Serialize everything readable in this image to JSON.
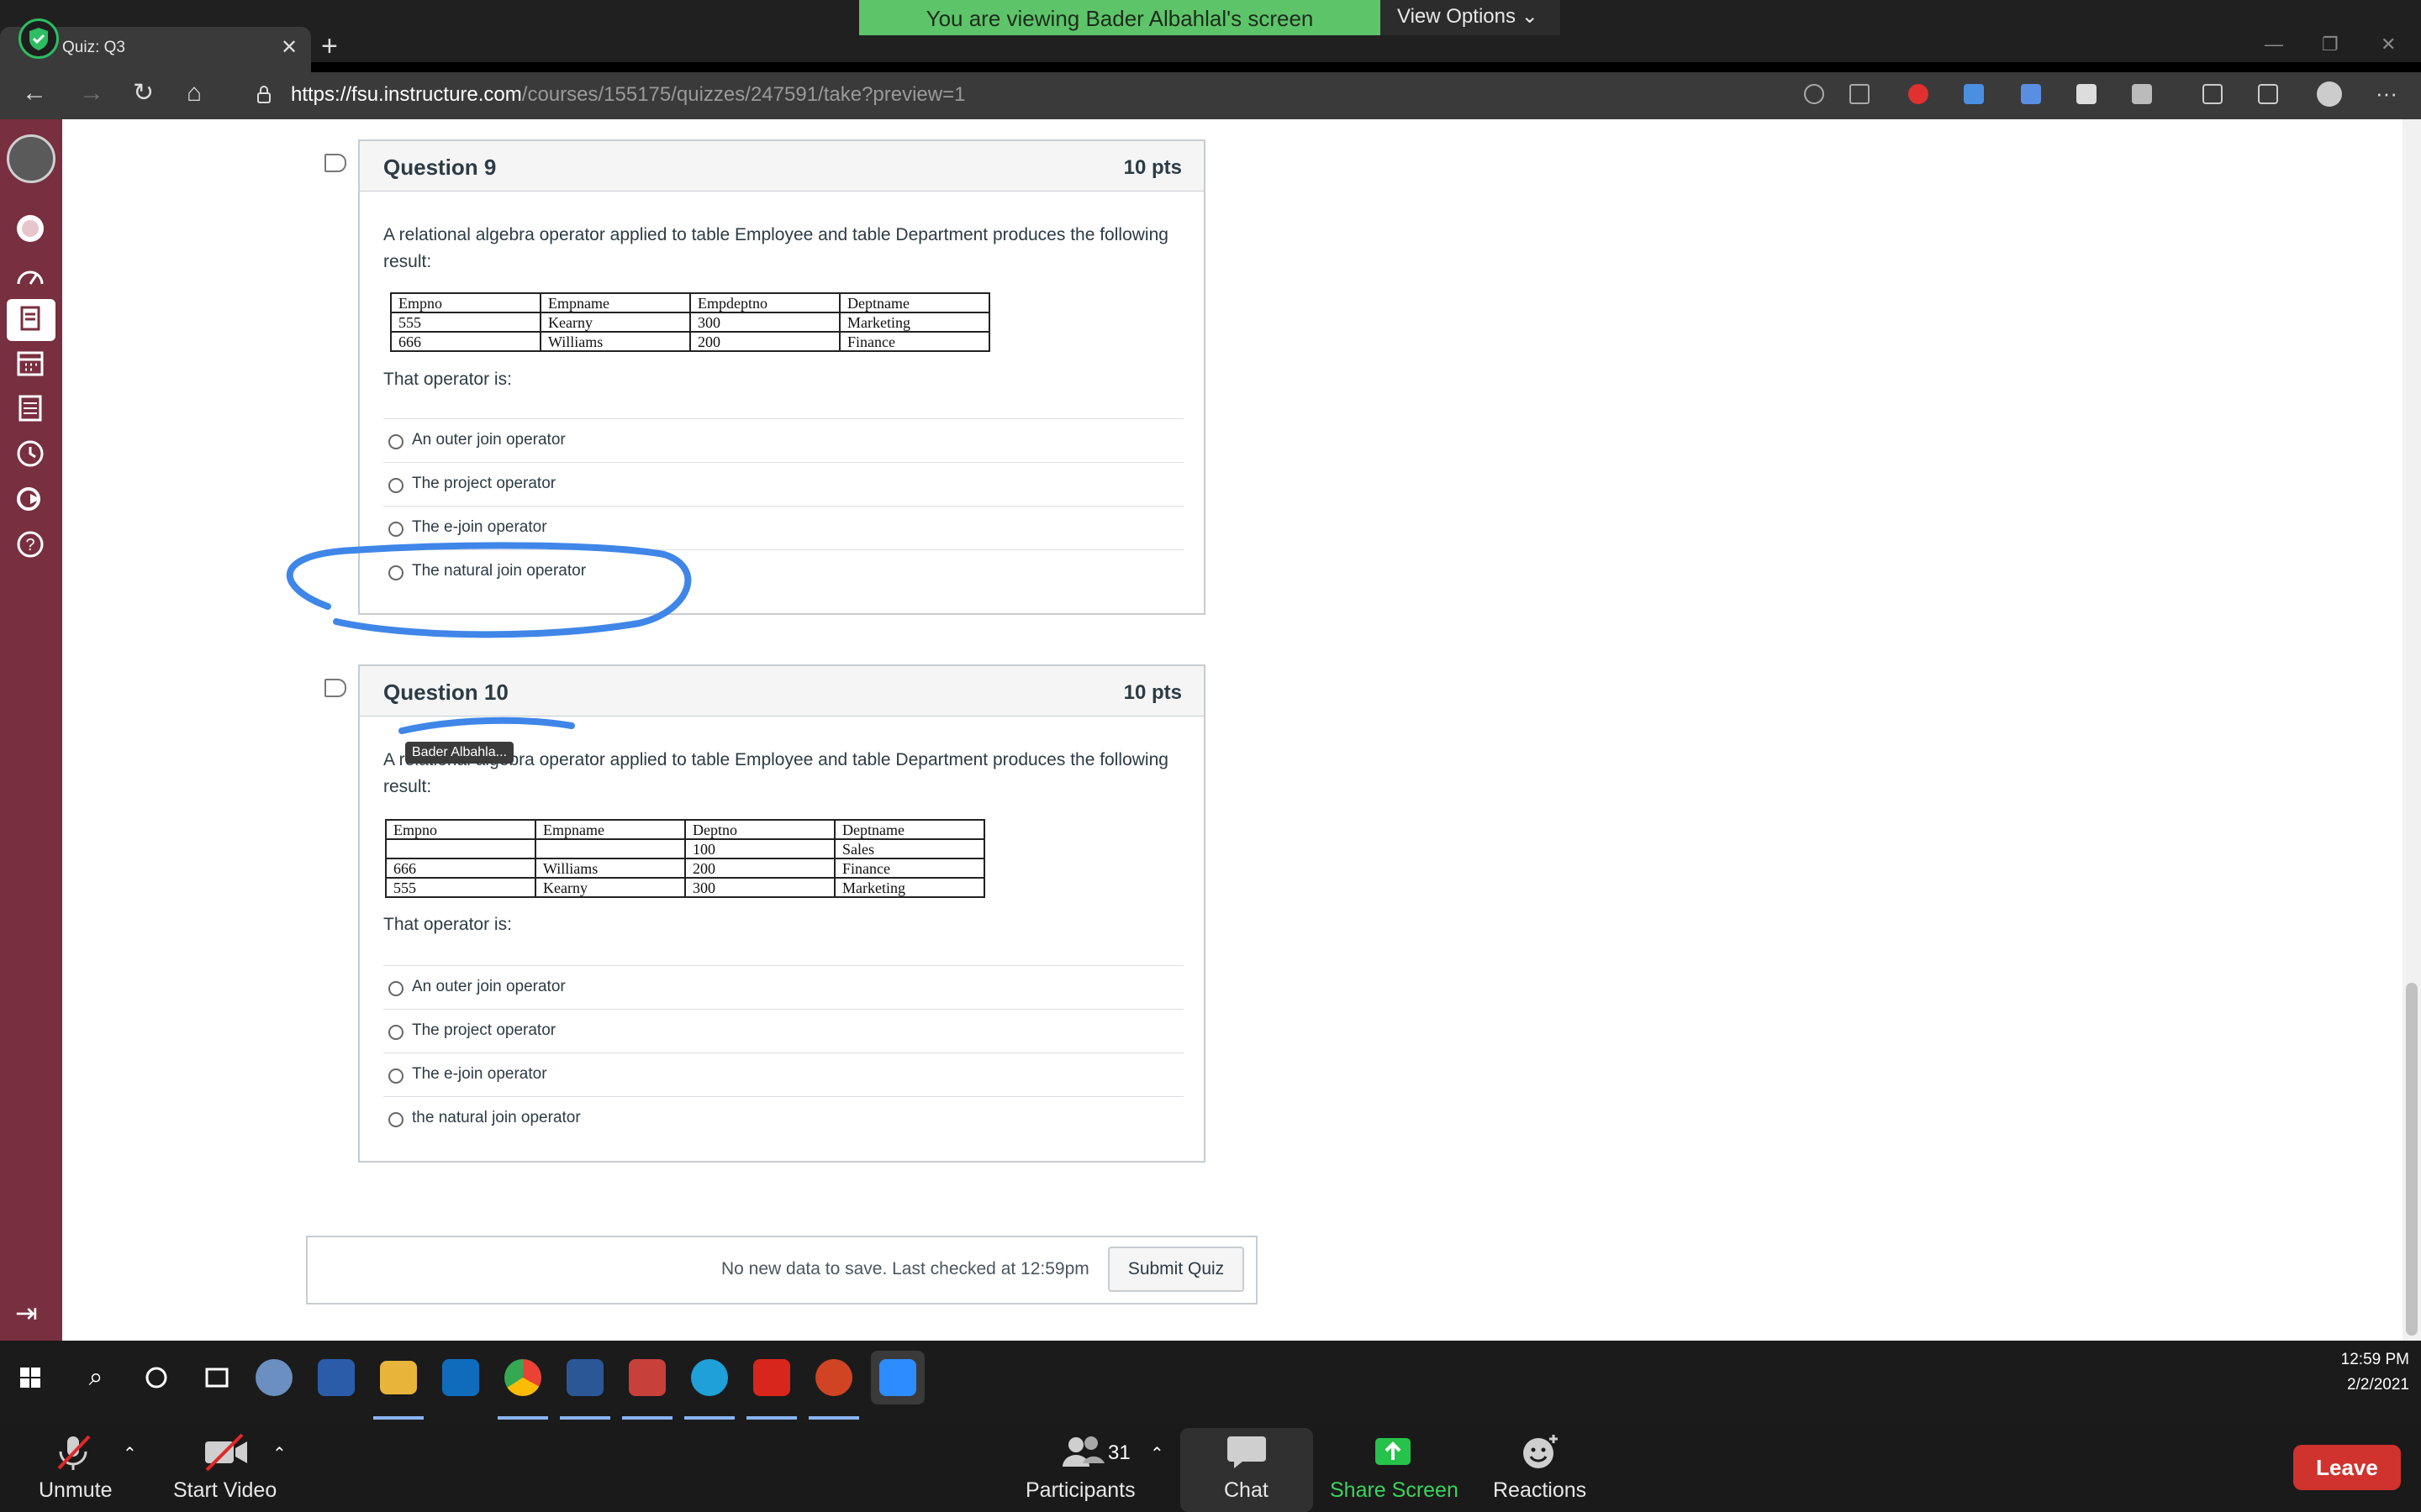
{
  "browser": {
    "tab_title": "Quiz: Q3",
    "url_host": "https://fsu.instructure.com",
    "url_path": "/courses/155175/quizzes/247591/take?preview=1"
  },
  "zoom_share": {
    "banner": "You are viewing Bader Albahlal's screen",
    "view_options": "View Options",
    "presenter_tag": "Bader Albahla..."
  },
  "questions": [
    {
      "name": "Question 9",
      "points": "10 pts",
      "text": "A relational algebra operator applied to table Employee and table Department produces the following result:",
      "table": {
        "headers": [
          "Empno",
          "Empname",
          "Empdeptno",
          "Deptname"
        ],
        "rows": [
          [
            "555",
            "Kearny",
            "300",
            "Marketing"
          ],
          [
            "666",
            "Williams",
            "200",
            "Finance"
          ]
        ]
      },
      "prompt": "That operator is:",
      "answers": [
        "An outer join operator",
        "The project operator",
        "The e-join operator",
        "The natural join operator"
      ]
    },
    {
      "name": "Question 10",
      "points": "10 pts",
      "text": "A relational algebra operator applied to table Employee and table Department produces the following result:",
      "table": {
        "headers": [
          "Empno",
          "Empname",
          "Deptno",
          "Deptname"
        ],
        "rows": [
          [
            "",
            "",
            "100",
            "Sales"
          ],
          [
            "666",
            "Williams",
            "200",
            "Finance"
          ],
          [
            "555",
            "Kearny",
            "300",
            "Marketing"
          ]
        ]
      },
      "prompt": "That operator is:",
      "answers": [
        "An outer join operator",
        "The project operator",
        "The e-join operator",
        "the natural join operator"
      ]
    }
  ],
  "footer": {
    "save_status": "No new data to save. Last checked at 12:59pm",
    "submit_label": "Submit Quiz"
  },
  "taskbar": {
    "time": "12:59 PM",
    "date": "2/2/2021"
  },
  "zoom": {
    "unmute": "Unmute",
    "start_video": "Start Video",
    "participants_count": "31",
    "participants": "Participants",
    "chat": "Chat",
    "share_screen": "Share Screen",
    "reactions": "Reactions",
    "leave": "Leave"
  },
  "colors": {
    "canvas_nav": "#782f40",
    "share_banner": "#5ec46a",
    "leave": "#d0322d",
    "ink": "#3f86e8"
  }
}
